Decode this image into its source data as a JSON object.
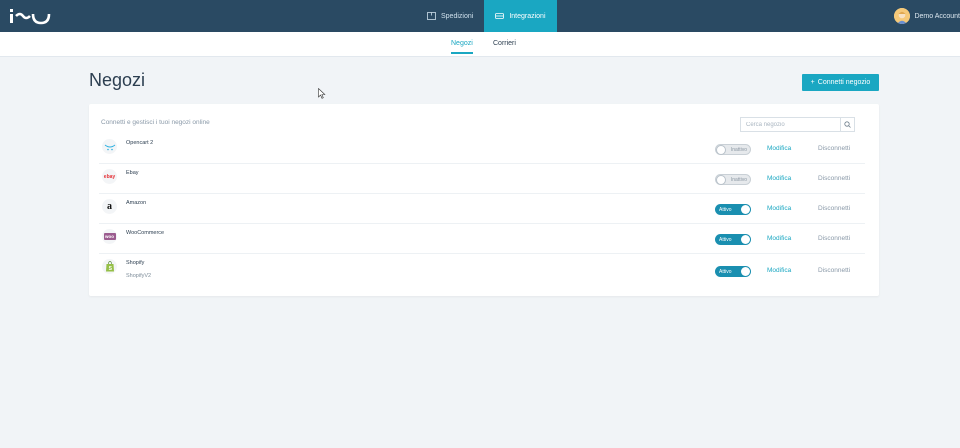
{
  "header": {
    "nav": [
      {
        "label": "Spedizioni",
        "icon": "box-icon",
        "active": false
      },
      {
        "label": "Integrazioni",
        "icon": "plug-icon",
        "active": true
      }
    ],
    "account_name": "Demo Account"
  },
  "subtabs": [
    {
      "label": "Negozi",
      "active": true
    },
    {
      "label": "Corrieri",
      "active": false
    }
  ],
  "page": {
    "title": "Negozi",
    "connect_button": "Connetti negozio"
  },
  "card": {
    "description": "Connetti e gestisci i tuoi negozi online",
    "search_placeholder": "Cerca negozio"
  },
  "stores": [
    {
      "name": "Opencart 2",
      "sub": "",
      "status": "Inattivo",
      "active": false,
      "edit": "Modifica",
      "disconnect": "Disconnetti",
      "logo": "opencart-logo"
    },
    {
      "name": "Ebay",
      "sub": "",
      "status": "Inattivo",
      "active": false,
      "edit": "Modifica",
      "disconnect": "Disconnetti",
      "logo": "ebay-logo",
      "logo_text": "ebay"
    },
    {
      "name": "Amazon",
      "sub": "",
      "status": "Attivo",
      "active": true,
      "edit": "Modifica",
      "disconnect": "Disconnetti",
      "logo": "amazon-logo",
      "logo_text": "a"
    },
    {
      "name": "WooCommerce",
      "sub": "",
      "status": "Attivo",
      "active": true,
      "edit": "Modifica",
      "disconnect": "Disconnetti",
      "logo": "woocommerce-logo",
      "logo_text": "woo"
    },
    {
      "name": "Shopify",
      "sub": "ShopifyV2",
      "status": "Attivo",
      "active": true,
      "edit": "Modifica",
      "disconnect": "Disconnetti",
      "logo": "shopify-logo"
    }
  ],
  "colors": {
    "topbar": "#2a4a63",
    "accent": "#1aa7c2",
    "toggle_on": "#1a8fb0"
  }
}
